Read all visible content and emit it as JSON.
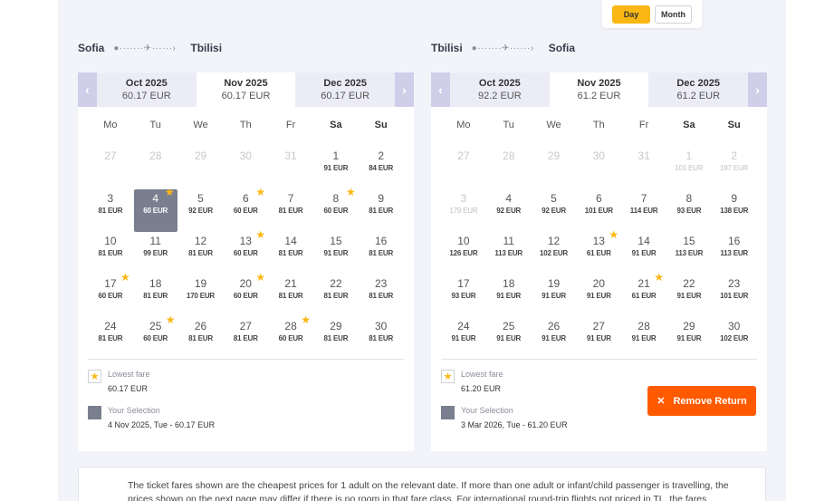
{
  "view_toggle": {
    "day": "Day",
    "month": "Month",
    "active": "day",
    "accent": "#fbb713"
  },
  "outbound": {
    "from": "Sofia",
    "to": "Tbilisi",
    "prev_label": "‹",
    "next_label": "›",
    "months": [
      {
        "name": "Oct 2025",
        "price": "60.17 EUR"
      },
      {
        "name": "Nov 2025",
        "price": "60.17 EUR",
        "active": true
      },
      {
        "name": "Dec 2025",
        "price": "60.17 EUR"
      }
    ],
    "weekdays": [
      "Mo",
      "Tu",
      "We",
      "Th",
      "Fr",
      "Sa",
      "Su"
    ],
    "weeks": [
      [
        {
          "d": "27",
          "p": "",
          "dis": true
        },
        {
          "d": "28",
          "p": "",
          "dis": true
        },
        {
          "d": "29",
          "p": "",
          "dis": true
        },
        {
          "d": "30",
          "p": "",
          "dis": true
        },
        {
          "d": "31",
          "p": "",
          "dis": true
        },
        {
          "d": "1",
          "p": "91 EUR"
        },
        {
          "d": "2",
          "p": "84 EUR"
        }
      ],
      [
        {
          "d": "3",
          "p": "81 EUR"
        },
        {
          "d": "4",
          "p": "60 EUR",
          "sel": true,
          "star": true
        },
        {
          "d": "5",
          "p": "92 EUR"
        },
        {
          "d": "6",
          "p": "60 EUR",
          "star": true
        },
        {
          "d": "7",
          "p": "81 EUR"
        },
        {
          "d": "8",
          "p": "60 EUR",
          "star": true
        },
        {
          "d": "9",
          "p": "81 EUR"
        }
      ],
      [
        {
          "d": "10",
          "p": "81 EUR"
        },
        {
          "d": "11",
          "p": "99 EUR"
        },
        {
          "d": "12",
          "p": "81 EUR"
        },
        {
          "d": "13",
          "p": "60 EUR",
          "star": true
        },
        {
          "d": "14",
          "p": "81 EUR"
        },
        {
          "d": "15",
          "p": "91 EUR"
        },
        {
          "d": "16",
          "p": "81 EUR"
        }
      ],
      [
        {
          "d": "17",
          "p": "60 EUR",
          "star": true
        },
        {
          "d": "18",
          "p": "81 EUR"
        },
        {
          "d": "19",
          "p": "170 EUR"
        },
        {
          "d": "20",
          "p": "60 EUR",
          "star": true
        },
        {
          "d": "21",
          "p": "81 EUR"
        },
        {
          "d": "22",
          "p": "81 EUR"
        },
        {
          "d": "23",
          "p": "81 EUR"
        }
      ],
      [
        {
          "d": "24",
          "p": "81 EUR"
        },
        {
          "d": "25",
          "p": "60 EUR",
          "star": true
        },
        {
          "d": "26",
          "p": "81 EUR"
        },
        {
          "d": "27",
          "p": "81 EUR"
        },
        {
          "d": "28",
          "p": "60 EUR",
          "star": true
        },
        {
          "d": "29",
          "p": "81 EUR"
        },
        {
          "d": "30",
          "p": "81 EUR"
        }
      ]
    ],
    "lowest_label": "Lowest fare",
    "lowest_value": "60.17 EUR",
    "selection_label": "Your Selection",
    "selection_value": "4 Nov 2025, Tue - 60.17 EUR"
  },
  "return": {
    "from": "Tbilisi",
    "to": "Sofia",
    "prev_label": "‹",
    "next_label": "›",
    "months": [
      {
        "name": "Oct 2025",
        "price": "92.2 EUR"
      },
      {
        "name": "Nov 2025",
        "price": "61.2 EUR",
        "active": true
      },
      {
        "name": "Dec 2025",
        "price": "61.2 EUR"
      }
    ],
    "weekdays": [
      "Mo",
      "Tu",
      "We",
      "Th",
      "Fr",
      "Sa",
      "Su"
    ],
    "weeks": [
      [
        {
          "d": "27",
          "p": "",
          "dis": true
        },
        {
          "d": "28",
          "p": "",
          "dis": true
        },
        {
          "d": "29",
          "p": "",
          "dis": true
        },
        {
          "d": "30",
          "p": "",
          "dis": true
        },
        {
          "d": "31",
          "p": "",
          "dis": true
        },
        {
          "d": "1",
          "p": "101 EUR",
          "dis": true
        },
        {
          "d": "2",
          "p": "197 EUR",
          "dis": true
        }
      ],
      [
        {
          "d": "3",
          "p": "179 EUR",
          "dis": true
        },
        {
          "d": "4",
          "p": "92 EUR"
        },
        {
          "d": "5",
          "p": "92 EUR"
        },
        {
          "d": "6",
          "p": "101 EUR"
        },
        {
          "d": "7",
          "p": "114 EUR"
        },
        {
          "d": "8",
          "p": "93 EUR"
        },
        {
          "d": "9",
          "p": "138 EUR"
        }
      ],
      [
        {
          "d": "10",
          "p": "126 EUR"
        },
        {
          "d": "11",
          "p": "113 EUR"
        },
        {
          "d": "12",
          "p": "102 EUR"
        },
        {
          "d": "13",
          "p": "61 EUR",
          "star": true
        },
        {
          "d": "14",
          "p": "91 EUR"
        },
        {
          "d": "15",
          "p": "113 EUR"
        },
        {
          "d": "16",
          "p": "113 EUR"
        }
      ],
      [
        {
          "d": "17",
          "p": "93 EUR"
        },
        {
          "d": "18",
          "p": "91 EUR"
        },
        {
          "d": "19",
          "p": "91 EUR"
        },
        {
          "d": "20",
          "p": "91 EUR"
        },
        {
          "d": "21",
          "p": "61 EUR",
          "star": true
        },
        {
          "d": "22",
          "p": "91 EUR"
        },
        {
          "d": "23",
          "p": "101 EUR"
        }
      ],
      [
        {
          "d": "24",
          "p": "91 EUR"
        },
        {
          "d": "25",
          "p": "91 EUR"
        },
        {
          "d": "26",
          "p": "91 EUR"
        },
        {
          "d": "27",
          "p": "91 EUR"
        },
        {
          "d": "28",
          "p": "91 EUR"
        },
        {
          "d": "29",
          "p": "91 EUR"
        },
        {
          "d": "30",
          "p": "102 EUR"
        }
      ]
    ],
    "lowest_label": "Lowest fare",
    "lowest_value": "61.20 EUR",
    "selection_label": "Your Selection",
    "selection_value": "3 Mar 2026, Tue - 61.20 EUR",
    "remove_label": "Remove Return"
  },
  "note_text": "The ticket fares shown are the cheapest prices for 1 adult on the relevant date. If more than one adult or infant/child passenger is travelling, the prices shown on the next page may differ if there is no room in that fare class. For international round-trip flights not priced in TL, the fares"
}
